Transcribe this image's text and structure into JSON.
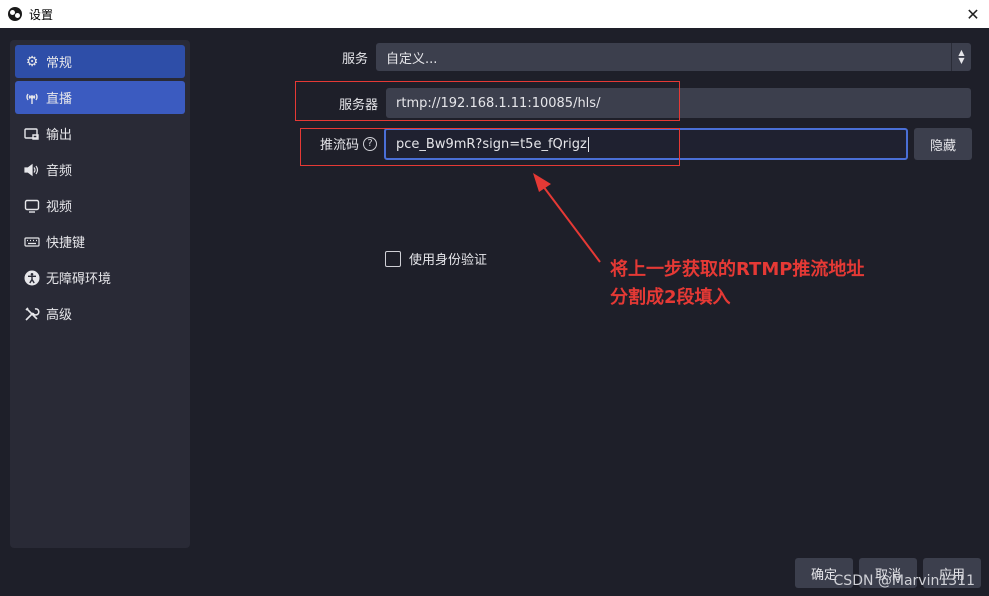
{
  "window": {
    "title": "设置"
  },
  "sidebar": {
    "items": [
      {
        "label": "常规",
        "icon": "gear-icon"
      },
      {
        "label": "直播",
        "icon": "broadcast-icon"
      },
      {
        "label": "输出",
        "icon": "output-icon"
      },
      {
        "label": "音频",
        "icon": "speaker-icon"
      },
      {
        "label": "视频",
        "icon": "monitor-icon"
      },
      {
        "label": "快捷键",
        "icon": "keyboard-icon"
      },
      {
        "label": "无障碍环境",
        "icon": "accessibility-icon"
      },
      {
        "label": "高级",
        "icon": "tools-icon"
      }
    ]
  },
  "stream": {
    "service_label": "服务",
    "service_value": "自定义...",
    "server_label": "服务器",
    "server_value": "rtmp://192.168.1.11:10085/hls/",
    "key_label": "推流码",
    "key_value": "pce_Bw9mR?sign=t5e_fQrigz",
    "hide_button": "隐藏",
    "auth_checkbox_label": "使用身份验证",
    "auth_checked": false
  },
  "annotation": {
    "line1": "将上一步获取的RTMP推流地址",
    "line2": "分割成2段填入",
    "color": "#e53935"
  },
  "footer": {
    "ok_button": "确定",
    "cancel_button": "取消",
    "apply_button": "应用"
  },
  "watermark": "CSDN @Marvin1311",
  "colors": {
    "background": "#1e1f29",
    "panel": "#292a36",
    "accent": "#3b5bc0",
    "field": "#3c3f4d"
  }
}
